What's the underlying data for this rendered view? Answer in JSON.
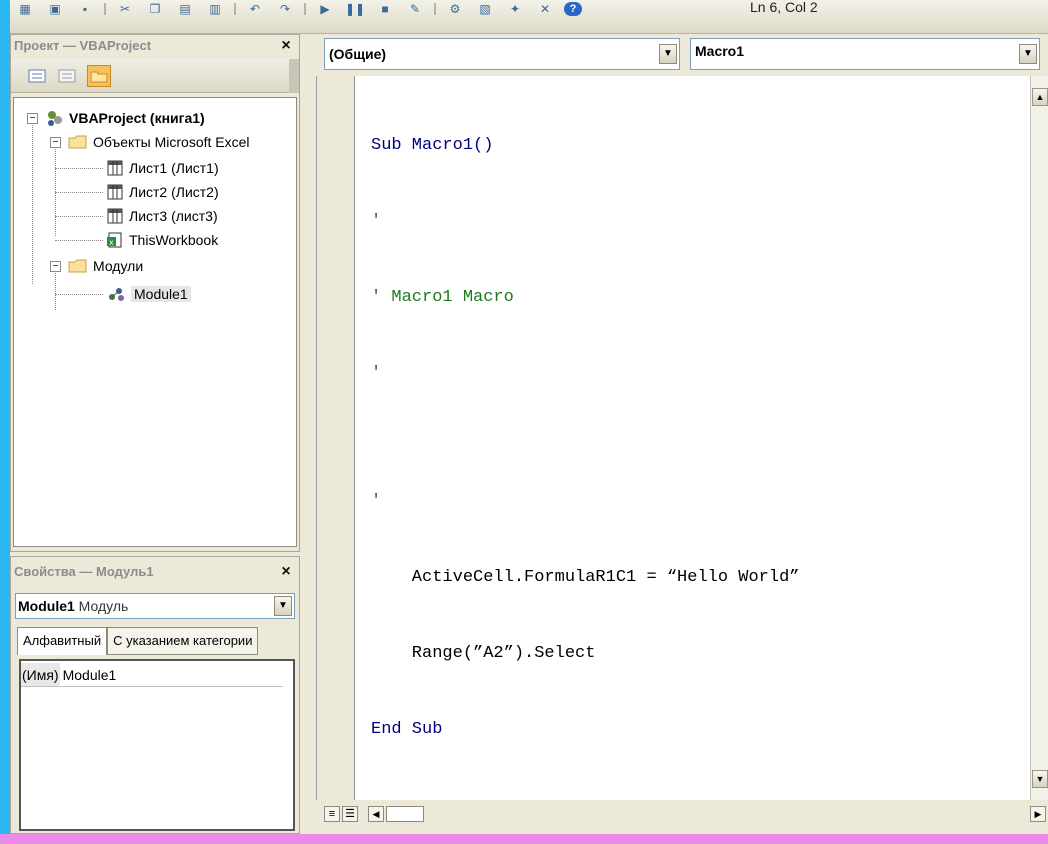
{
  "status": {
    "cursor_position": "Ln 6, Col 2"
  },
  "project_explorer": {
    "title": "Проект — VBAProject",
    "close_label": "×",
    "tree": {
      "root": "VBAProject (книга1)",
      "folders": [
        {
          "label": "Объекты Microsoft Excel",
          "items": [
            "Лист1 (Лист1)",
            "Лист2 (Лист2)",
            "Лист3 (лист3)",
            "ThisWorkbook"
          ]
        },
        {
          "label": "Модули",
          "items": [
            "Module1"
          ]
        }
      ]
    }
  },
  "properties": {
    "title": "Свойства — Модуль1",
    "close_label": "×",
    "object_name": "Module1",
    "object_type": "Модуль",
    "tabs": [
      "Алфавитный",
      "С указанием категории"
    ],
    "rows": [
      {
        "key": "(Имя)",
        "value": "Module1"
      }
    ]
  },
  "code_window": {
    "object_combo": "(Общие)",
    "procedure_combo": "Macro1",
    "lines": [
      {
        "type": "keyword",
        "text": "Sub Macro1()"
      },
      {
        "type": "comment",
        "text": "'"
      },
      {
        "type": "comment",
        "text": "' Macro1 Macro"
      },
      {
        "type": "comment",
        "text": "'"
      },
      {
        "type": "blank",
        "text": ""
      },
      {
        "type": "comment",
        "text": "'"
      },
      {
        "type": "code",
        "text": "    ActiveCell.FormulaR1C1 = “Hello World”"
      },
      {
        "type": "code",
        "text": "    Range(”A2”).Select"
      },
      {
        "type": "keyword",
        "text": "End Sub"
      }
    ]
  },
  "colors": {
    "keyword": "#00007f",
    "comment": "#1e7b1e",
    "frame_top": "#f070f0",
    "frame_side": "#1fb6f0"
  }
}
